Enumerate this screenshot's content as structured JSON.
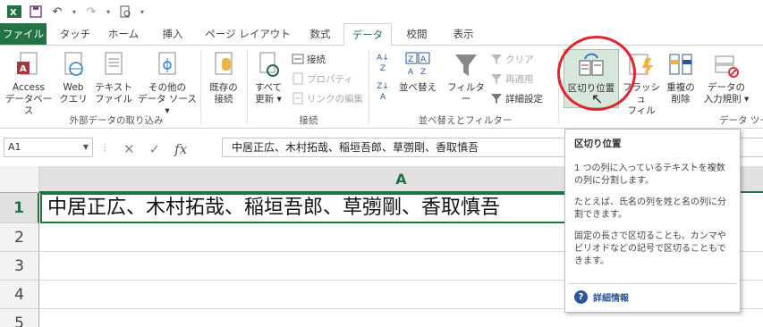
{
  "qat": {
    "undo_arrow": "▾",
    "redo_arrow": "▾",
    "more": "▾"
  },
  "tabs": [
    "ファイル",
    "タッチ",
    "ホーム",
    "挿入",
    "ページ レイアウト",
    "数式",
    "データ",
    "校閲",
    "表示"
  ],
  "active_tab": "データ",
  "ribbon": {
    "access": "Access\nデータベース",
    "web": "Web\nクエリ",
    "text": "テキスト\nファイル",
    "other": "その他の\nデータ ソース ▾",
    "existing": "既存の\n接続",
    "group_external": "外部データの取り込み",
    "refresh": "すべて\n更新 ▾",
    "connections": "接続",
    "properties": "プロパティ",
    "edit_links": "リンクの編集",
    "group_connections": "接続",
    "sort": "並べ替え",
    "filter": "フィルター",
    "clear": "クリア",
    "reapply": "再適用",
    "advanced": "詳細設定",
    "group_sort": "並べ替えとフィルター",
    "text_to_columns": "区切り位置",
    "flash_fill": "フラッシュ\nフィル",
    "remove_dup": "重複の\n削除",
    "validation": "データの\n入力規則 ▾",
    "group_tools": "データ ツー"
  },
  "namebox": {
    "value": "A1"
  },
  "formula": {
    "fx": "fx",
    "value": "中居正広、木村拓哉、稲垣吾郎、草彅剛、香取慎吾"
  },
  "grid": {
    "column": "A",
    "rows": [
      "1",
      "2",
      "3",
      "4",
      "5"
    ],
    "a1": "中居正広、木村拓哉、稲垣吾郎、草彅剛、香取慎吾"
  },
  "tooltip": {
    "title": "区切り位置",
    "p1": "1 つの列に入っているテキストを複数の列に分割します。",
    "p2": "たとえば、氏名の列を姓と名の列に分割できます。",
    "p3": "固定の長さで区切ることも、カンマやピリオドなどの記号で区切ることもできます。",
    "more": "詳細情報"
  },
  "colors": {
    "excel_green": "#217346",
    "highlight_circle": "#e0252b",
    "link_blue": "#2b579a"
  }
}
